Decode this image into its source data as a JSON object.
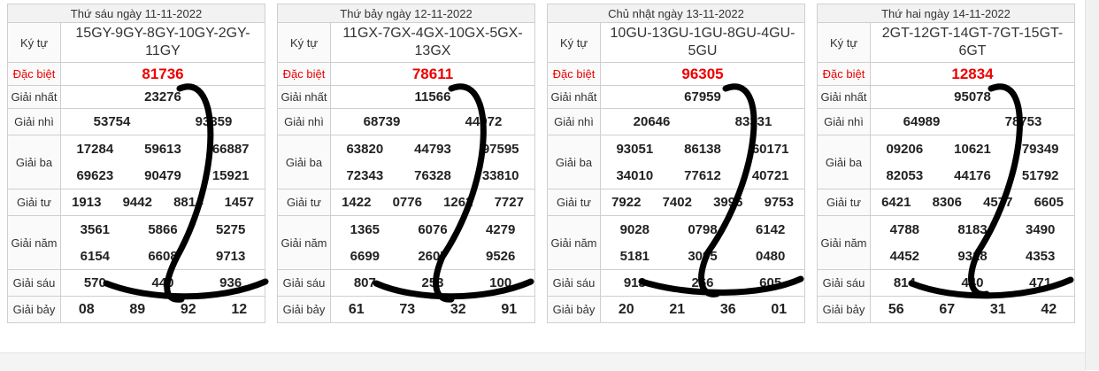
{
  "days": [
    {
      "header": "Thứ sáu ngày 11-11-2022",
      "ky_tu_label": "Ký tự",
      "ky_tu": "15GY-9GY-8GY-10GY-2GY-11GY",
      "dac_biet_label": "Đặc biệt",
      "dac_biet": "81736",
      "giai_nhat_label": "Giải nhất",
      "giai_nhat": "23276",
      "giai_nhi_label": "Giải nhì",
      "giai_nhi": [
        "53754",
        "93359"
      ],
      "giai_ba_label": "Giải ba",
      "giai_ba": [
        "17284",
        "59613",
        "66887",
        "69623",
        "90479",
        "15921"
      ],
      "giai_tu_label": "Giải tư",
      "giai_tu": [
        "1913",
        "9442",
        "8814",
        "1457"
      ],
      "giai_nam_label": "Giải năm",
      "giai_nam": [
        "3561",
        "5866",
        "5275",
        "6154",
        "6608",
        "9713"
      ],
      "giai_sau_label": "Giải sáu",
      "giai_sau": [
        "570",
        "440",
        "936"
      ],
      "giai_bay_label": "Giải bảy",
      "giai_bay": [
        "08",
        "89",
        "92",
        "12"
      ]
    },
    {
      "header": "Thứ bảy ngày 12-11-2022",
      "ky_tu_label": "Ký tự",
      "ky_tu": "11GX-7GX-4GX-10GX-5GX-13GX",
      "dac_biet_label": "Đặc biệt",
      "dac_biet": "78611",
      "giai_nhat_label": "Giải nhất",
      "giai_nhat": "11566",
      "giai_nhi_label": "Giải nhì",
      "giai_nhi": [
        "68739",
        "44972"
      ],
      "giai_ba_label": "Giải ba",
      "giai_ba": [
        "63820",
        "44793",
        "97595",
        "72343",
        "76328",
        "33810"
      ],
      "giai_tu_label": "Giải tư",
      "giai_tu": [
        "1422",
        "0776",
        "1262",
        "7727"
      ],
      "giai_nam_label": "Giải năm",
      "giai_nam": [
        "1365",
        "6076",
        "4279",
        "6699",
        "2607",
        "9526"
      ],
      "giai_sau_label": "Giải sáu",
      "giai_sau": [
        "807",
        "253",
        "100"
      ],
      "giai_bay_label": "Giải bảy",
      "giai_bay": [
        "61",
        "73",
        "32",
        "91"
      ]
    },
    {
      "header": "Chủ nhật ngày 13-11-2022",
      "ky_tu_label": "Ký tự",
      "ky_tu": "10GU-13GU-1GU-8GU-4GU-5GU",
      "dac_biet_label": "Đặc biệt",
      "dac_biet": "96305",
      "giai_nhat_label": "Giải nhất",
      "giai_nhat": "67959",
      "giai_nhi_label": "Giải nhì",
      "giai_nhi": [
        "20646",
        "83331"
      ],
      "giai_ba_label": "Giải ba",
      "giai_ba": [
        "93051",
        "86138",
        "60171",
        "34010",
        "77612",
        "40721"
      ],
      "giai_tu_label": "Giải tư",
      "giai_tu": [
        "7922",
        "7402",
        "3996",
        "9753"
      ],
      "giai_nam_label": "Giải năm",
      "giai_nam": [
        "9028",
        "0798",
        "6142",
        "5181",
        "3095",
        "0480"
      ],
      "giai_sau_label": "Giải sáu",
      "giai_sau": [
        "913",
        "266",
        "605"
      ],
      "giai_bay_label": "Giải bảy",
      "giai_bay": [
        "20",
        "21",
        "36",
        "01"
      ]
    },
    {
      "header": "Thứ hai ngày 14-11-2022",
      "ky_tu_label": "Ký tự",
      "ky_tu": "2GT-12GT-14GT-7GT-15GT-6GT",
      "dac_biet_label": "Đặc biệt",
      "dac_biet": "12834",
      "giai_nhat_label": "Giải nhất",
      "giai_nhat": "95078",
      "giai_nhi_label": "Giải nhì",
      "giai_nhi": [
        "64989",
        "78753"
      ],
      "giai_ba_label": "Giải ba",
      "giai_ba": [
        "09206",
        "10621",
        "79349",
        "82053",
        "44176",
        "51792"
      ],
      "giai_tu_label": "Giải tư",
      "giai_tu": [
        "6421",
        "8306",
        "4577",
        "6605"
      ],
      "giai_nam_label": "Giải năm",
      "giai_nam": [
        "4788",
        "8183",
        "3490",
        "4452",
        "9318",
        "4353"
      ],
      "giai_sau_label": "Giải sáu",
      "giai_sau": [
        "814",
        "440",
        "471"
      ],
      "giai_bay_label": "Giải bảy",
      "giai_bay": [
        "56",
        "67",
        "31",
        "42"
      ]
    }
  ],
  "colors": {
    "red": "#e00000",
    "ink": "#000000",
    "border": "#cfcfcf"
  }
}
